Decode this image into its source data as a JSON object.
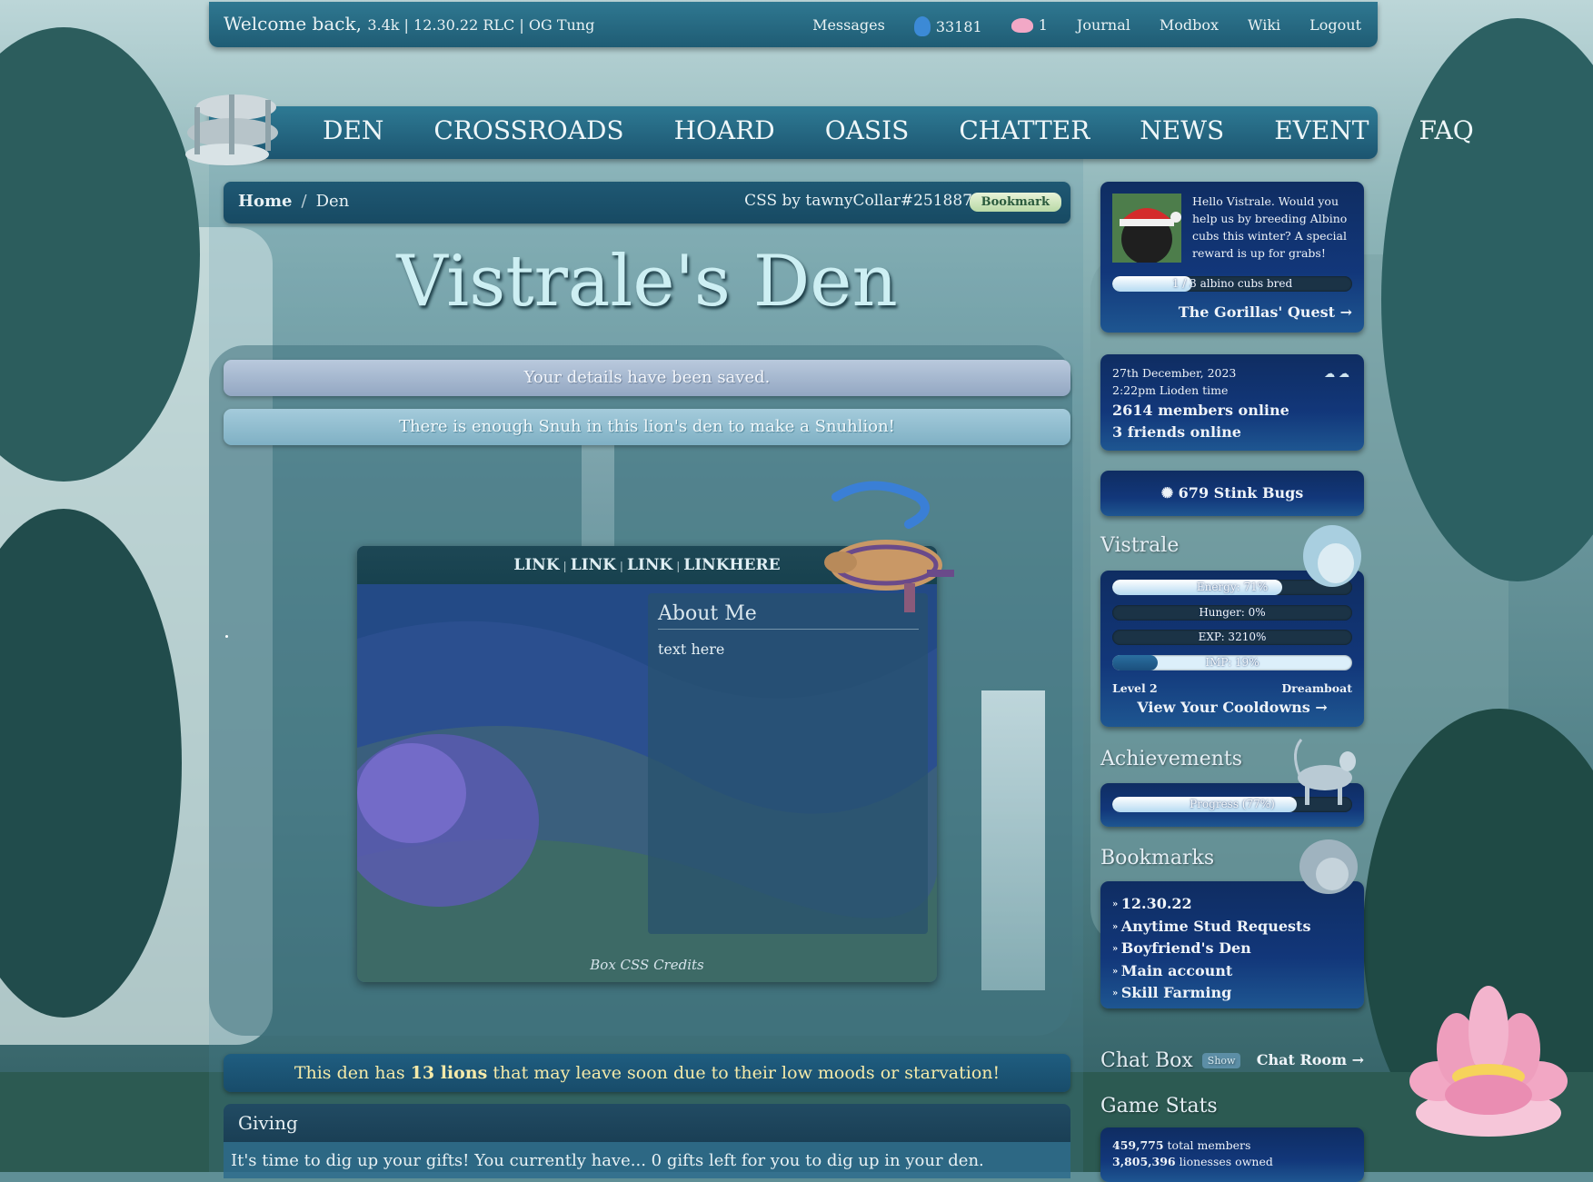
{
  "topbar": {
    "welcome_prefix": "Welcome back,",
    "welcome_name": "3.4k | 12.30.22 RLC | OG Tung",
    "links": {
      "messages": "Messages",
      "shells": "33181",
      "lotus": "1",
      "journal": "Journal",
      "modbox": "Modbox",
      "wiki": "Wiki",
      "logout": "Logout"
    }
  },
  "nav": {
    "items": [
      "DEN",
      "CROSSROADS",
      "HOARD",
      "OASIS",
      "CHATTER",
      "NEWS",
      "EVENT",
      "FAQ"
    ]
  },
  "breadcrumb": {
    "home": "Home",
    "separator": "/",
    "current": "Den",
    "css_credit": "CSS by tawnyCollar#251887",
    "bookmark": "Bookmark"
  },
  "page_title": "Vistrale's Den",
  "notices": {
    "saved": "Your details have been saved.",
    "snuh": "There is enough Snuh in this lion's den to make a Snuhlion!"
  },
  "denbox": {
    "links": [
      "LINK",
      "LINK",
      "LINK",
      "LINKHERE"
    ],
    "about_heading": "About Me",
    "about_text": "text here",
    "credits": "Box CSS Credits"
  },
  "warning": {
    "prefix": "This den has",
    "count": "13 lions",
    "suffix": "that may leave soon due to their low moods or starvation!"
  },
  "giving": {
    "heading": "Giving",
    "text": "It's time to dig up your gifts! You currently have... 0 gifts left for you to dig up in your den."
  },
  "sidebar": {
    "quest": {
      "message": "Hello Vistrale. Would you help us by breeding Albino cubs this winter? A special reward is up for grabs!",
      "progress_label": "1 / 3 albino cubs bred",
      "progress": 0.333,
      "link": "The Gorillas' Quest →"
    },
    "time": {
      "date": "27th December, 2023",
      "time": "2:22pm Lioden time",
      "members": "2614 members online",
      "friends": "3 friends online"
    },
    "bugs": "679 Stink Bugs",
    "lion": {
      "name": "Vistrale",
      "bars": [
        {
          "label": "Energy: 71%",
          "value": 0.71
        },
        {
          "label": "Hunger: 0%",
          "value": 0
        },
        {
          "label": "EXP: 3210%",
          "value": 0
        },
        {
          "label": "IMP: 19%",
          "value": 0.19
        }
      ],
      "level": "Level 2",
      "title": "Dreamboat",
      "cooldowns": "View Your Cooldowns →"
    },
    "achievements": {
      "heading": "Achievements",
      "progress_label": "Progress (77%)",
      "progress": 0.77
    },
    "bookmarks": {
      "heading": "Bookmarks",
      "items": [
        "12.30.22",
        "Anytime Stud Requests",
        "Boyfriend's Den",
        "Main account",
        "Skill Farming"
      ]
    },
    "chat": {
      "heading": "Chat Box",
      "show": "Show",
      "room": "Chat Room →"
    },
    "game_stats": {
      "heading": "Game Stats",
      "rows": [
        {
          "value": "459,775",
          "label": "total members"
        },
        {
          "value": "3,805,396",
          "label": "lionesses owned"
        }
      ]
    }
  },
  "colors": {
    "accent": "#1f5c74",
    "card": "#12377a",
    "warning_text": "#f4eaa9"
  }
}
